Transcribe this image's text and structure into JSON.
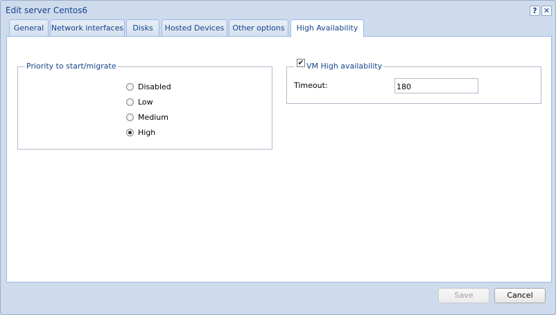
{
  "window": {
    "title": "Edit server Centos6",
    "help_label": "?",
    "close_label": "✕"
  },
  "tabs": [
    {
      "label": "General"
    },
    {
      "label": "Network interfaces"
    },
    {
      "label": "Disks"
    },
    {
      "label": "Hosted Devices"
    },
    {
      "label": "Other options"
    },
    {
      "label": "High Availability",
      "active": true
    }
  ],
  "priority": {
    "legend": "Priority to start/migrate",
    "options": [
      "Disabled",
      "Low",
      "Medium",
      "High"
    ],
    "selected": "High"
  },
  "ha": {
    "legend": "VM High availability",
    "checked": true,
    "timeout_label": "Timeout:",
    "timeout_value": "180"
  },
  "buttons": {
    "save": "Save",
    "cancel": "Cancel"
  }
}
